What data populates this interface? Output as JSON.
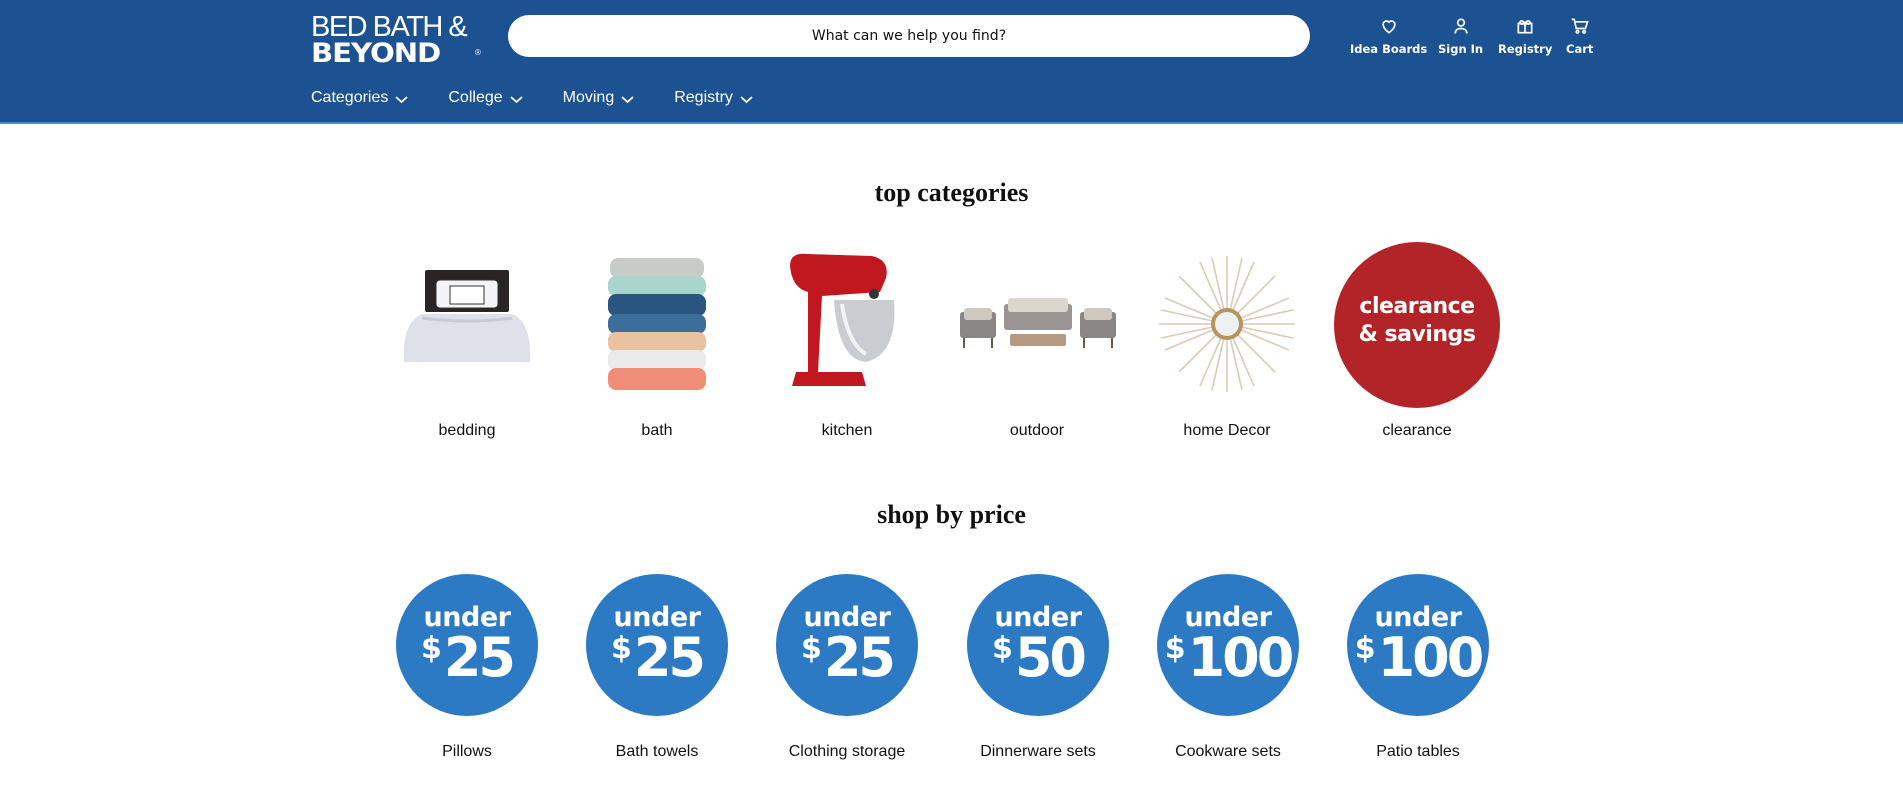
{
  "header": {
    "logo_line1": "BED BATH &",
    "logo_line2": "BEYOND",
    "logo_reg": "®",
    "search_placeholder": "What can we help you find?",
    "utilities": [
      {
        "label": "Idea Boards",
        "icon": "heart-icon"
      },
      {
        "label": "Sign In",
        "icon": "user-icon"
      },
      {
        "label": "Registry",
        "icon": "gift-icon"
      },
      {
        "label": "Cart",
        "icon": "cart-icon"
      }
    ],
    "nav": [
      {
        "label": "Categories"
      },
      {
        "label": "College"
      },
      {
        "label": "Moving"
      },
      {
        "label": "Registry"
      }
    ]
  },
  "top_categories": {
    "title": "top categories",
    "items": [
      {
        "label": "bedding"
      },
      {
        "label": "bath"
      },
      {
        "label": "kitchen"
      },
      {
        "label": "outdoor"
      },
      {
        "label": "home Decor"
      },
      {
        "label": "clearance",
        "badge_line1": "clearance",
        "badge_line2": "& savings"
      }
    ]
  },
  "shop_by_price": {
    "title": "shop by price",
    "items": [
      {
        "under": "under",
        "currency": "$",
        "amount": "25",
        "label": "Pillows"
      },
      {
        "under": "under",
        "currency": "$",
        "amount": "25",
        "label": "Bath towels"
      },
      {
        "under": "under",
        "currency": "$",
        "amount": "25",
        "label": "Clothing storage"
      },
      {
        "under": "under",
        "currency": "$",
        "amount": "50",
        "label": "Dinnerware sets"
      },
      {
        "under": "under",
        "currency": "$",
        "amount": "100",
        "label": "Cookware sets"
      },
      {
        "under": "under",
        "currency": "$",
        "amount": "100",
        "label": "Patio tables"
      }
    ]
  },
  "colors": {
    "header_bg": "#1c5192",
    "price_circle": "#2c79c4",
    "clearance_red": "#b22428"
  }
}
